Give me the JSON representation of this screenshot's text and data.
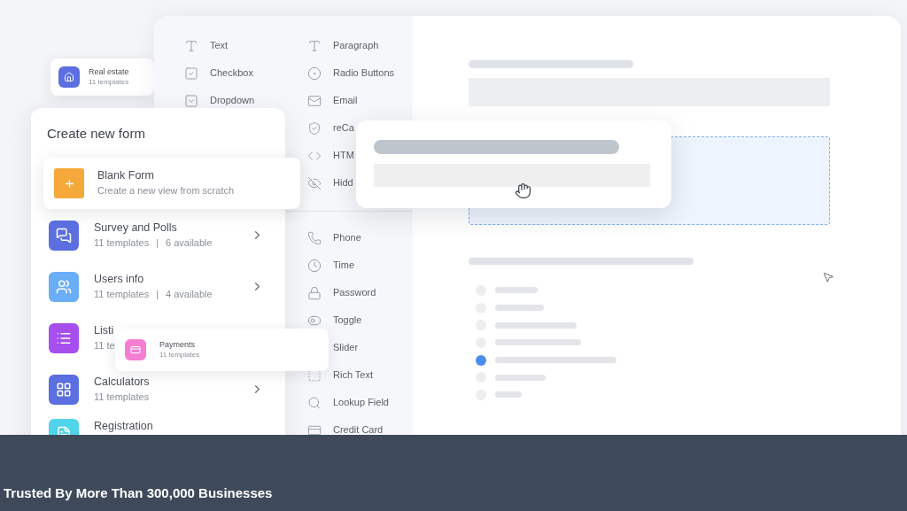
{
  "featured_templates": [
    {
      "kind": "home",
      "title": "Real estate",
      "subtitle": "11 templates",
      "color": "#5b6fe0"
    },
    {
      "kind": "payment",
      "title": "Payments",
      "subtitle": "11 templates",
      "color": "#f47fd2"
    }
  ],
  "field_palette": {
    "column_1": [
      {
        "kind": "text",
        "label": "Text"
      },
      {
        "kind": "checkbox",
        "label": "Checkbox"
      },
      {
        "kind": "dropdown",
        "label": "Dropdown"
      }
    ],
    "column_2": [
      {
        "kind": "text",
        "label": "Paragraph"
      },
      {
        "kind": "radio",
        "label": "Radio Buttons"
      },
      {
        "kind": "email",
        "label": "Email"
      },
      {
        "kind": "captcha",
        "label": "reCa"
      },
      {
        "kind": "html",
        "label": "HTM"
      },
      {
        "kind": "hidden",
        "label": "Hidd"
      }
    ],
    "column_2_more": [
      {
        "kind": "phone",
        "label": "Phone"
      },
      {
        "kind": "time",
        "label": "Time"
      },
      {
        "kind": "password",
        "label": "Password"
      },
      {
        "kind": "toggle",
        "label": "Toggle"
      },
      {
        "kind": "covered",
        "label": "Slider"
      },
      {
        "kind": "richtext",
        "label": "Rich Text"
      },
      {
        "kind": "lookup",
        "label": "Lookup Field"
      },
      {
        "kind": "card",
        "label": "Credit Card"
      }
    ]
  },
  "create_form": {
    "title": "Create new form",
    "blank_form": {
      "title": "Blank Form",
      "subtitle": "Create a new view from scratch",
      "color": "#f4a93a"
    },
    "categories": [
      {
        "kind": "chat",
        "title": "Survey and Polls",
        "templates": "11 templates",
        "separator": "|",
        "available": "6 available",
        "has_arrow": true,
        "color": "#5b6fe0"
      },
      {
        "kind": "users",
        "title": "Users info",
        "templates": "11 templates",
        "separator": "|",
        "available": "4 available",
        "has_arrow": true,
        "color": "#6aaef8"
      },
      {
        "kind": "list",
        "title": "Listi",
        "templates": "11 te",
        "color": "#a64ef0"
      },
      {
        "kind": "grid",
        "title": "Calculators",
        "templates": "11 templates",
        "has_arrow": true,
        "color": "#5b6fe0"
      },
      {
        "kind": "form",
        "title": "Registration",
        "color": "#4fd4ec"
      }
    ]
  },
  "canvas": {
    "skeleton_options": [
      {
        "selected": false
      },
      {
        "selected": false
      },
      {
        "selected": false
      },
      {
        "selected": false
      },
      {
        "selected": true
      },
      {
        "selected": false
      },
      {
        "selected": false
      }
    ]
  },
  "footer": {
    "text": "Trusted By More Than 300,000 Businesses"
  }
}
